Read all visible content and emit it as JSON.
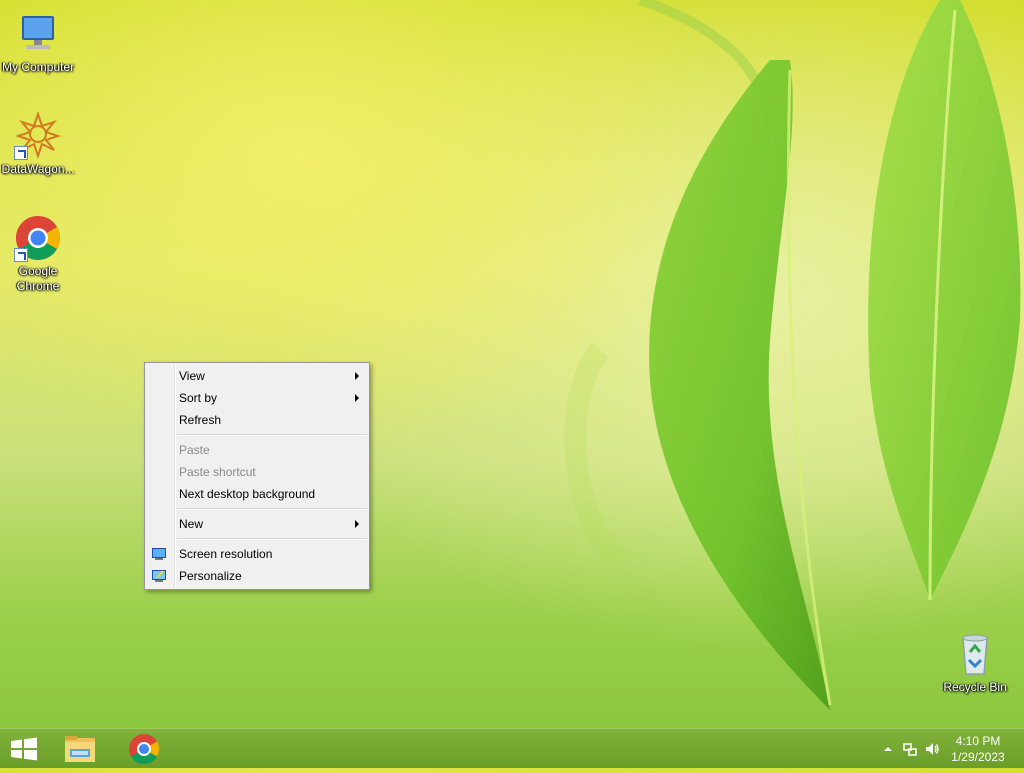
{
  "desktop": {
    "icons": [
      {
        "label": "My Computer"
      },
      {
        "label": "DataWagon..."
      },
      {
        "label": "Google Chrome"
      },
      {
        "label": "Recycle Bin"
      }
    ]
  },
  "context_menu": {
    "items": [
      {
        "label": "View",
        "submenu": true,
        "enabled": true
      },
      {
        "label": "Sort by",
        "submenu": true,
        "enabled": true
      },
      {
        "label": "Refresh",
        "enabled": true
      },
      {
        "label": "Paste",
        "enabled": false
      },
      {
        "label": "Paste shortcut",
        "enabled": false
      },
      {
        "label": "Next desktop background",
        "enabled": true
      },
      {
        "label": "New",
        "submenu": true,
        "enabled": true
      },
      {
        "label": "Screen resolution",
        "icon": "display-icon",
        "enabled": true
      },
      {
        "label": "Personalize",
        "icon": "personalize-icon",
        "enabled": true
      }
    ]
  },
  "taskbar": {
    "pinned": [
      {
        "name": "start",
        "icon": "windows-logo-icon"
      },
      {
        "name": "file-explorer",
        "icon": "folder-icon"
      },
      {
        "name": "google-chrome",
        "icon": "chrome-icon"
      }
    ],
    "tray": {
      "time": "4:10 PM",
      "date": "1/29/2023",
      "icons": [
        "show-hidden-icons-icon",
        "network-icon",
        "volume-icon"
      ]
    }
  },
  "colors": {
    "taskbar": "#78a830",
    "menu_bg": "#f0f0f0",
    "disabled_text": "#8a8a8a"
  }
}
